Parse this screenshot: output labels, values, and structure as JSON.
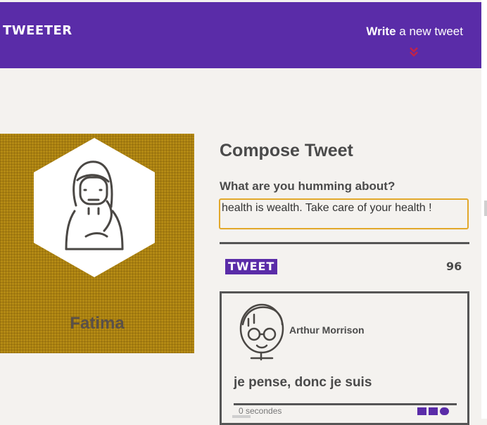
{
  "nav": {
    "logo": "TWEETER",
    "write_strong": "Write",
    "write_rest": " a new tweet",
    "chevron_icon": "double-chevron-down-icon",
    "chevron_color": "#c0234a"
  },
  "profile": {
    "name": "Fatima",
    "avatar_icon": "woman-avatar-icon"
  },
  "compose": {
    "title": "Compose Tweet",
    "prompt": "What are you humming about?",
    "input_value": "health is wealth. Take care of your health !",
    "button_label": "TWEET",
    "counter": "96"
  },
  "tweet": {
    "author": "Arthur Morrison",
    "text": "je pense, donc je suis",
    "timestamp": "0 secondes",
    "avatar_icon": "man-glasses-avatar-icon",
    "action_icons": [
      "flag-icon",
      "retweet-icon",
      "heart-icon"
    ]
  },
  "colors": {
    "brand": "#5a2ca8",
    "background": "#f4f2ef",
    "profile_bg": "#b48a14",
    "input_border": "#e2a82a"
  }
}
